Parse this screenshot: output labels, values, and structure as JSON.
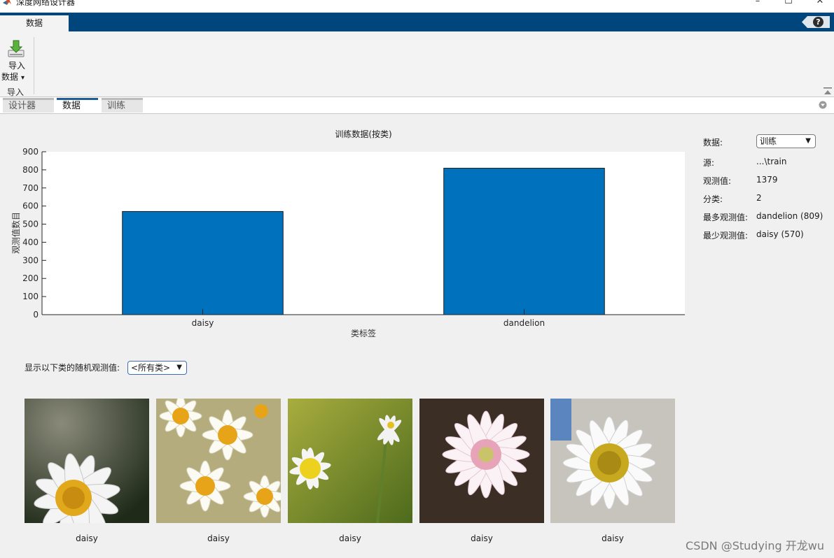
{
  "window": {
    "title": "深度网络设计器",
    "minimize": "–",
    "maximize": "☐",
    "close": "✕"
  },
  "ribbon": {
    "active_tab": "数据",
    "import_button": {
      "line1": "导入",
      "line2": "数据",
      "caret": "▾"
    },
    "group_label": "导入",
    "help": "?"
  },
  "doc_tabs": [
    {
      "label": "设计器",
      "active": false
    },
    {
      "label": "数据",
      "active": true
    },
    {
      "label": "训练",
      "active": false
    }
  ],
  "chart_data": {
    "type": "bar",
    "title": "训练数据(按类)",
    "xlabel": "类标签",
    "ylabel": "观测值数目",
    "categories": [
      "daisy",
      "dandelion"
    ],
    "values": [
      570,
      809
    ],
    "ylim": [
      0,
      900
    ],
    "yticks": [
      0,
      100,
      200,
      300,
      400,
      500,
      600,
      700,
      800,
      900
    ],
    "bar_color": "#0072bd",
    "grid": false
  },
  "info_panel": {
    "data_label": "数据:",
    "data_dropdown": "训练",
    "rows": [
      {
        "label": "源:",
        "value": "...\\train"
      },
      {
        "label": "观测值:",
        "value": "1379"
      },
      {
        "label": "分类:",
        "value": "2"
      },
      {
        "label": "最多观测值:",
        "value": "dandelion (809)"
      },
      {
        "label": "最少观测值:",
        "value": "daisy (570)"
      }
    ]
  },
  "observations": {
    "filter_label": "显示以下类的随机观测值:",
    "filter_value": "<所有类>",
    "images": [
      {
        "label": "daisy"
      },
      {
        "label": "daisy"
      },
      {
        "label": "daisy"
      },
      {
        "label": "daisy"
      },
      {
        "label": "daisy"
      }
    ]
  },
  "watermark": "CSDN @Studying 开龙wu",
  "colors": {
    "accent": "#00457c",
    "bar": "#0072bd",
    "active_tab_border": "#1f5d99"
  }
}
